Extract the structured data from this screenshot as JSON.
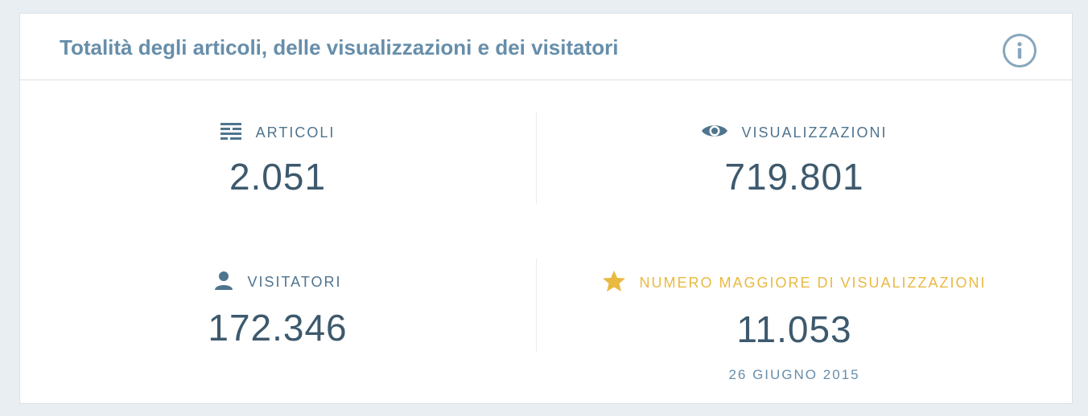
{
  "card": {
    "title": "Totalità degli articoli, delle visualizzazioni e dei visitatori",
    "info_icon": "info-icon"
  },
  "stats": {
    "posts": {
      "icon": "posts-icon",
      "label": "ARTICOLI",
      "value": "2.051"
    },
    "views": {
      "icon": "eye-icon",
      "label": "VISUALIZZAZIONI",
      "value": "719.801"
    },
    "visitors": {
      "icon": "person-icon",
      "label": "VISITATORI",
      "value": "172.346"
    },
    "best": {
      "icon": "star-icon",
      "label": "NUMERO MAGGIORE DI VISUALIZZAZIONI",
      "value": "11.053",
      "date": "26 GIUGNO 2015"
    }
  },
  "colors": {
    "title": "#668eaa",
    "label": "#4f748e",
    "value": "#3d596d",
    "highlight": "#e9b941",
    "border": "#d8e1e8",
    "background": "#e9eef2"
  }
}
